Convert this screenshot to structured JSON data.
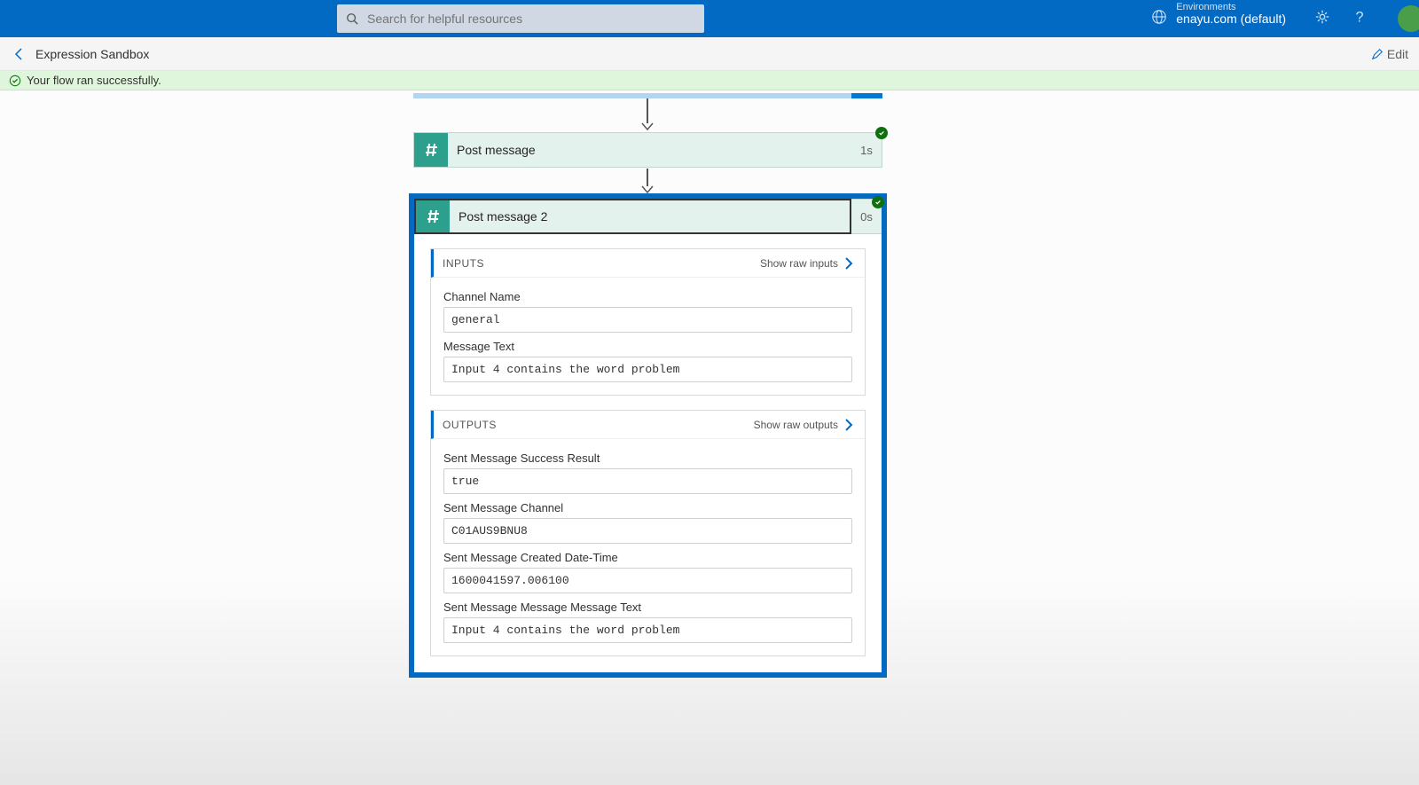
{
  "header": {
    "search_placeholder": "Search for helpful resources",
    "env_label": "Environments",
    "env_value": "enayu.com (default)"
  },
  "crumb": {
    "title": "Expression Sandbox",
    "edit": "Edit"
  },
  "notification": "Your flow ran successfully.",
  "card1": {
    "title": "Post message",
    "duration": "1s"
  },
  "card2": {
    "title": "Post message 2",
    "duration": "0s",
    "inputs": {
      "heading": "INPUTS",
      "link": "Show raw inputs",
      "fields": {
        "channel_label": "Channel Name",
        "channel_value": "general",
        "msg_label": "Message Text",
        "msg_value": "Input 4 contains the word problem"
      }
    },
    "outputs": {
      "heading": "OUTPUTS",
      "link": "Show raw outputs",
      "fields": {
        "success_label": "Sent Message Success Result",
        "success_value": "true",
        "channel_label": "Sent Message Channel",
        "channel_value": "C01AUS9BNU8",
        "time_label": "Sent Message Created Date-Time",
        "time_value": "1600041597.006100",
        "text_label": "Sent Message Message Message Text",
        "text_value": "Input 4 contains the word problem"
      }
    }
  }
}
